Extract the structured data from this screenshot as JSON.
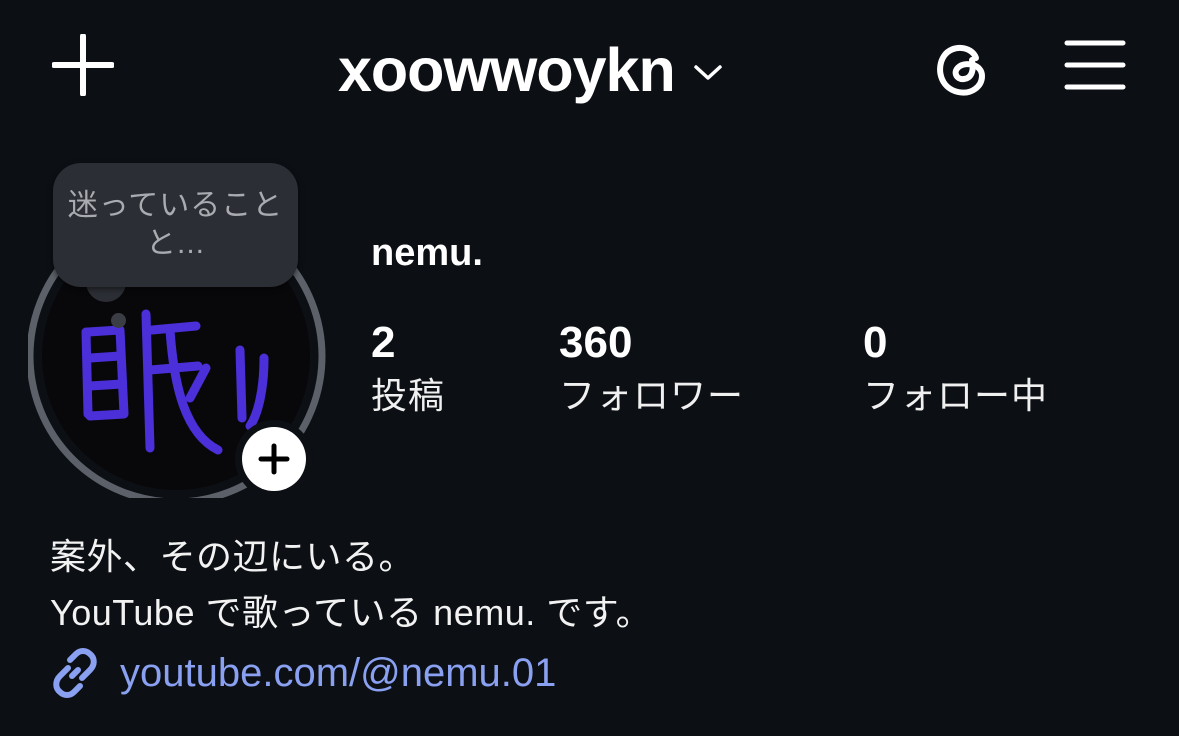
{
  "header": {
    "username": "xoowwoykn",
    "icons": {
      "new_post": "plus-icon",
      "account_switch": "chevron-down-icon",
      "threads": "threads-icon",
      "menu": "hamburger-menu-icon"
    }
  },
  "profile": {
    "note": "迷っていること...",
    "note_line1": "迷っていること",
    "note_line2": "と...",
    "display_name": "nemu.",
    "avatar_glyph": "眠い"
  },
  "stats": [
    {
      "value": "2",
      "label": "投稿"
    },
    {
      "value": "360",
      "label": "フォロワー"
    },
    {
      "value": "0",
      "label": "フォロー中"
    }
  ],
  "bio": {
    "line1": "案外、その辺にいる。",
    "line2": "YouTube で歌っている nemu. です。",
    "link": "youtube.com/@nemu.01"
  },
  "colors": {
    "background": "#0c0f14",
    "link": "#8aa0f0",
    "avatar_stroke": "#4b2fd8",
    "note_bubble": "#2b2e34"
  }
}
